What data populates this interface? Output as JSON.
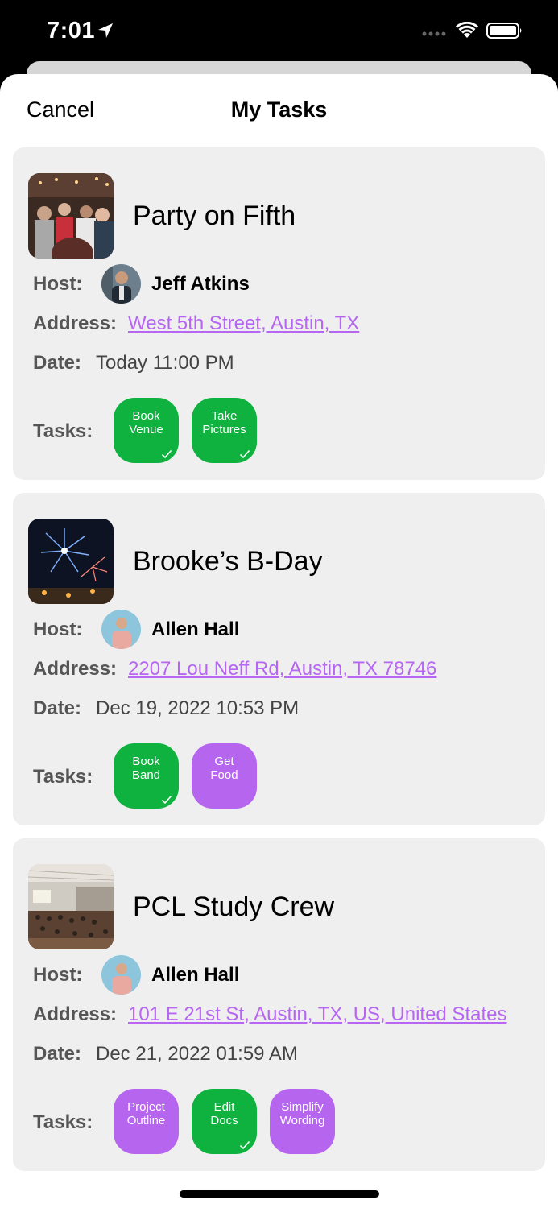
{
  "status_bar": {
    "time": "7:01"
  },
  "nav": {
    "cancel_label": "Cancel",
    "title": "My Tasks"
  },
  "labels": {
    "host": "Host:",
    "address": "Address:",
    "date": "Date:",
    "tasks": "Tasks:"
  },
  "events": [
    {
      "title": "Party on Fifth",
      "image": "party-crowd-photo",
      "host": "Jeff Atkins",
      "address": "West 5th Street, Austin, TX",
      "date": "Today 11:00 PM",
      "tasks": [
        {
          "line1": "Book",
          "line2": "Venue",
          "completed": true
        },
        {
          "line1": "Take",
          "line2": "Pictures",
          "completed": true
        }
      ]
    },
    {
      "title": "Brooke’s B-Day",
      "image": "fireworks-photo",
      "host": "Allen Hall",
      "address": "2207 Lou Neff Rd, Austin, TX 78746",
      "date": "Dec 19, 2022 10:53 PM",
      "tasks": [
        {
          "line1": "Book",
          "line2": "Band",
          "completed": true
        },
        {
          "line1": "Get",
          "line2": "Food",
          "completed": false
        }
      ]
    },
    {
      "title": "PCL Study Crew",
      "image": "lecture-hall-photo",
      "host": "Allen Hall",
      "address": "101 E 21st St, Austin, TX, US, United States",
      "date": "Dec 21, 2022 01:59 AM",
      "tasks": [
        {
          "line1": "Project",
          "line2": "Outline",
          "completed": false
        },
        {
          "line1": "Edit",
          "line2": "Docs",
          "completed": true
        },
        {
          "line1": "Simplify",
          "line2": "Wording",
          "completed": false
        }
      ]
    }
  ],
  "colors": {
    "completed": "#0fb23f",
    "pending": "#b666ee",
    "link": "#b666f2",
    "card": "#efefef"
  }
}
